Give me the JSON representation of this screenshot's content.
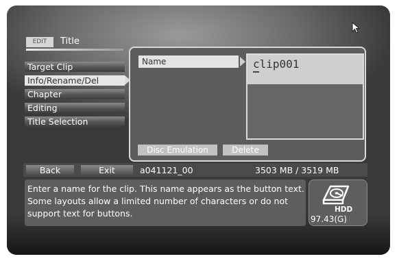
{
  "header": {
    "edit_tag": "EDIT",
    "title": "Title"
  },
  "menu": {
    "items": [
      {
        "label": "Target Clip"
      },
      {
        "label": "Info/Rename/Del"
      },
      {
        "label": "Chapter"
      },
      {
        "label": "Editing"
      },
      {
        "label": "Title Selection"
      }
    ],
    "selected_index": 1
  },
  "panel": {
    "name_label": "Name",
    "clip_name": "clip001",
    "disc_emulation_label": "Disc Emulation",
    "delete_label": "Delete"
  },
  "status": {
    "back_label": "Back",
    "exit_label": "Exit",
    "project": "a041121_00",
    "usage": "3503 MB / 3519 MB"
  },
  "help": {
    "text": "Enter a name for the clip. This name appears as the button text. Some layouts allow a limited number of characters or do not support text for buttons."
  },
  "hdd": {
    "label": "HDD",
    "capacity": "97.43(G)"
  },
  "icons": [
    "mouse-pointer-icon",
    "right-arrow-icon",
    "hdd-icon"
  ],
  "colors": {
    "highlight": "#e3e3e3",
    "panel": "#5c5c5c",
    "background": "#2e2e2e"
  }
}
